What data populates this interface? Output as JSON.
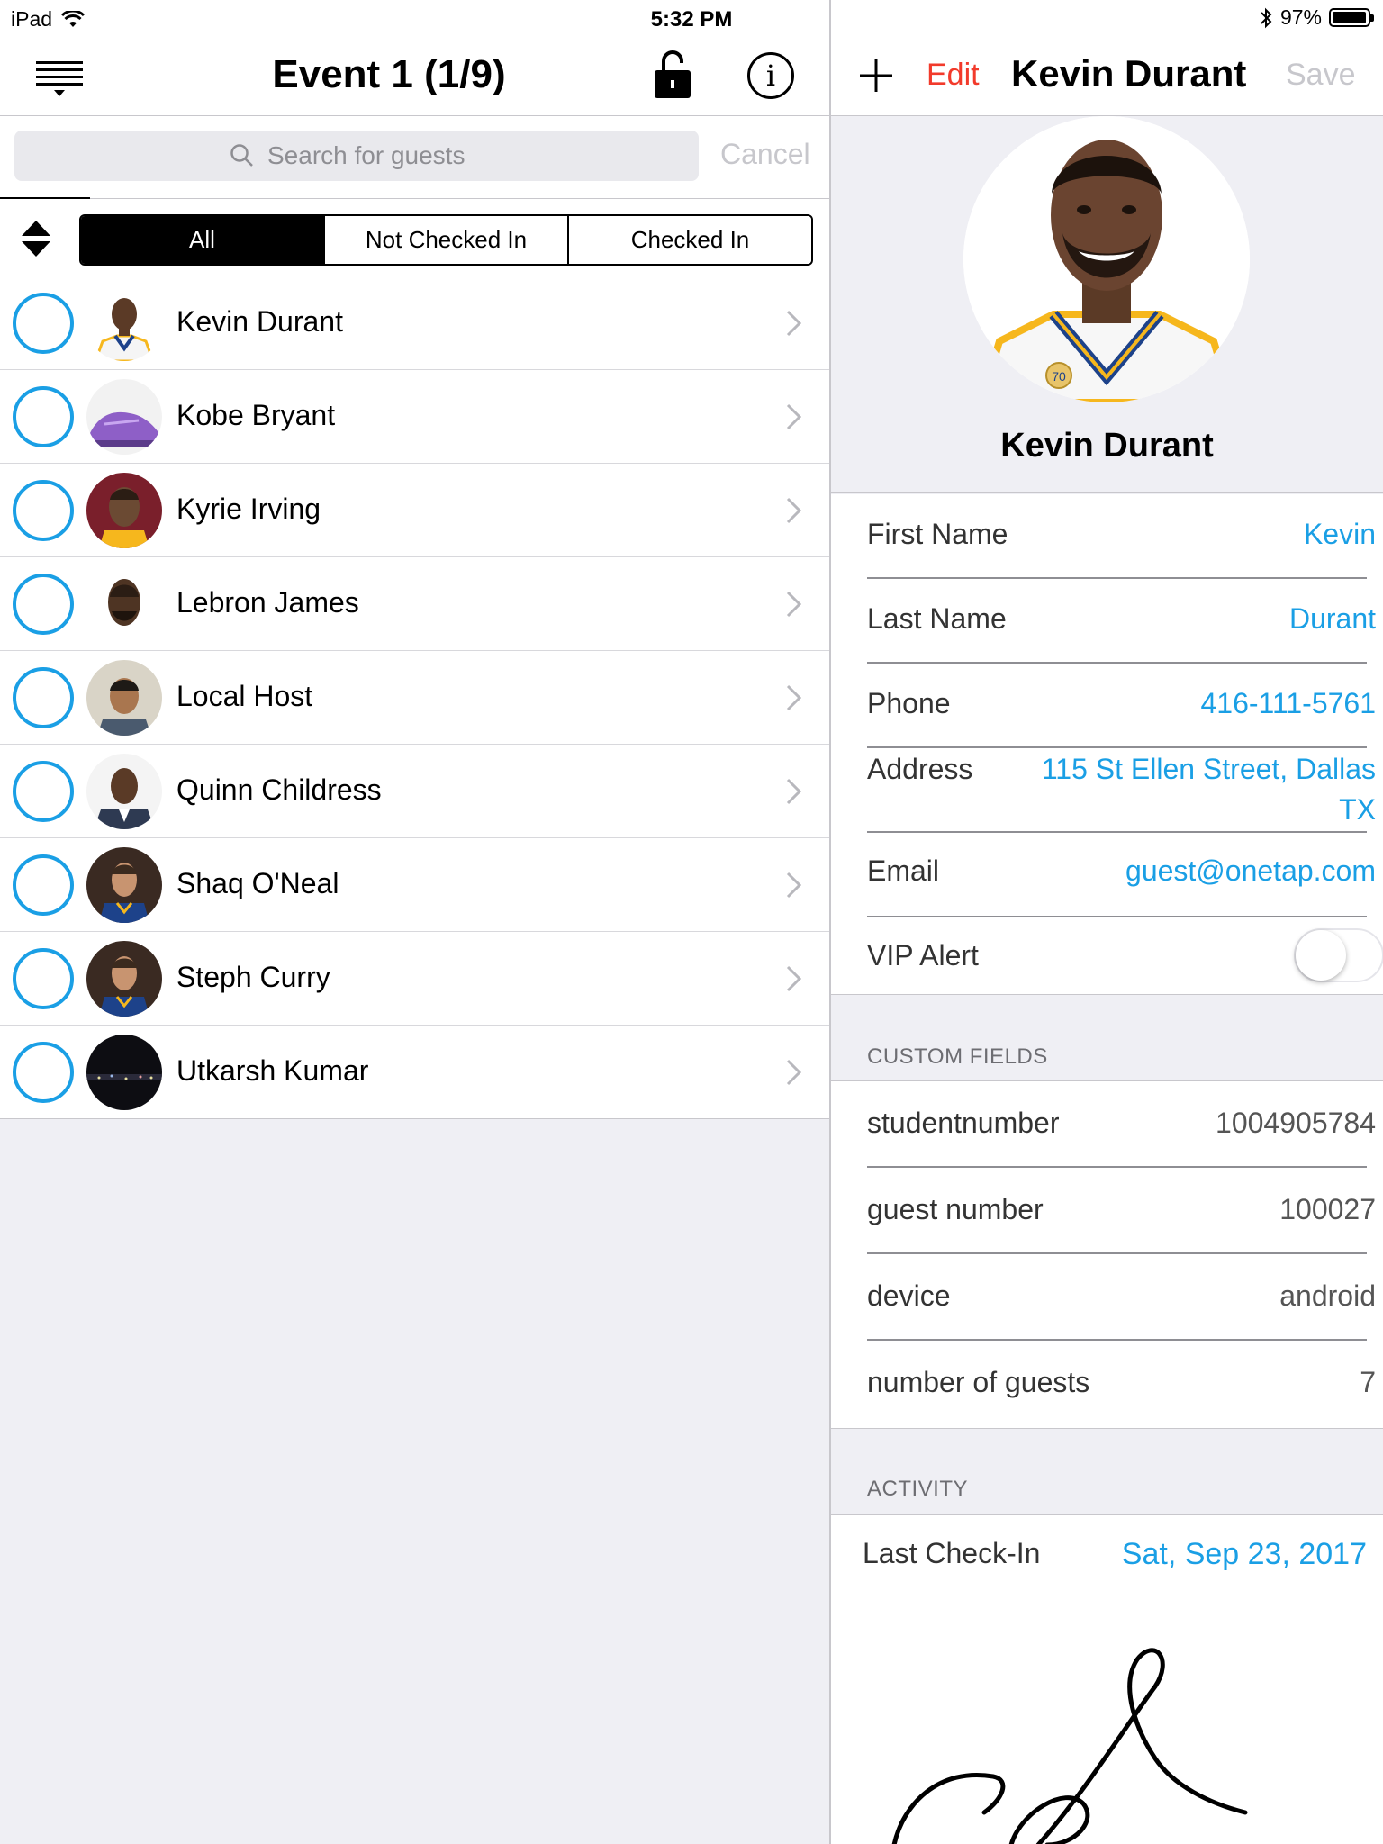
{
  "status_bar": {
    "device": "iPad",
    "time": "5:32 PM",
    "battery_text": "97%",
    "battery_level": 0.97
  },
  "left_nav": {
    "title": "Event 1 (1/9)"
  },
  "search": {
    "placeholder": "Search for guests",
    "cancel_label": "Cancel"
  },
  "filter": {
    "segments": [
      "All",
      "Not Checked In",
      "Checked In"
    ],
    "selected": "All"
  },
  "guests": [
    {
      "name": "Kevin Durant",
      "checked_in": false
    },
    {
      "name": "Kobe Bryant",
      "checked_in": false
    },
    {
      "name": "Kyrie Irving",
      "checked_in": false
    },
    {
      "name": "Lebron James",
      "checked_in": false
    },
    {
      "name": "Local Host",
      "checked_in": false
    },
    {
      "name": "Quinn Childress",
      "checked_in": false
    },
    {
      "name": "Shaq O'Neal",
      "checked_in": false
    },
    {
      "name": "Steph Curry",
      "checked_in": false
    },
    {
      "name": "Utkarsh Kumar",
      "checked_in": false
    }
  ],
  "right_nav": {
    "edit_label": "Edit",
    "title": "Kevin Durant",
    "save_label": "Save"
  },
  "profile": {
    "name": "Kevin Durant",
    "jersey_badge": "70"
  },
  "details": {
    "first_name_label": "First Name",
    "first_name": "Kevin",
    "last_name_label": "Last Name",
    "last_name": "Durant",
    "phone_label": "Phone",
    "phone": "416-111-5761",
    "address_label": "Address",
    "address_line1": "115 St Ellen Street, Dallas",
    "address_line2": "TX",
    "email_label": "Email",
    "email": "guest@onetap.com",
    "vip_label": "VIP Alert",
    "vip_enabled": false
  },
  "custom_fields": {
    "header": "CUSTOM FIELDS",
    "items": [
      {
        "label": "studentnumber",
        "value": "1004905784"
      },
      {
        "label": "guest number",
        "value": "100027"
      },
      {
        "label": "device",
        "value": "android"
      },
      {
        "label": "number of guests",
        "value": "7"
      }
    ]
  },
  "activity": {
    "header": "ACTIVITY",
    "last_checkin_label": "Last Check-In",
    "last_checkin_value": "Sat, Sep 23, 2017"
  },
  "colors": {
    "accent_blue": "#1a9fe5",
    "edit_red": "#f23a2b",
    "disabled_gray": "#c7c7cc",
    "background": "#efeff4"
  }
}
